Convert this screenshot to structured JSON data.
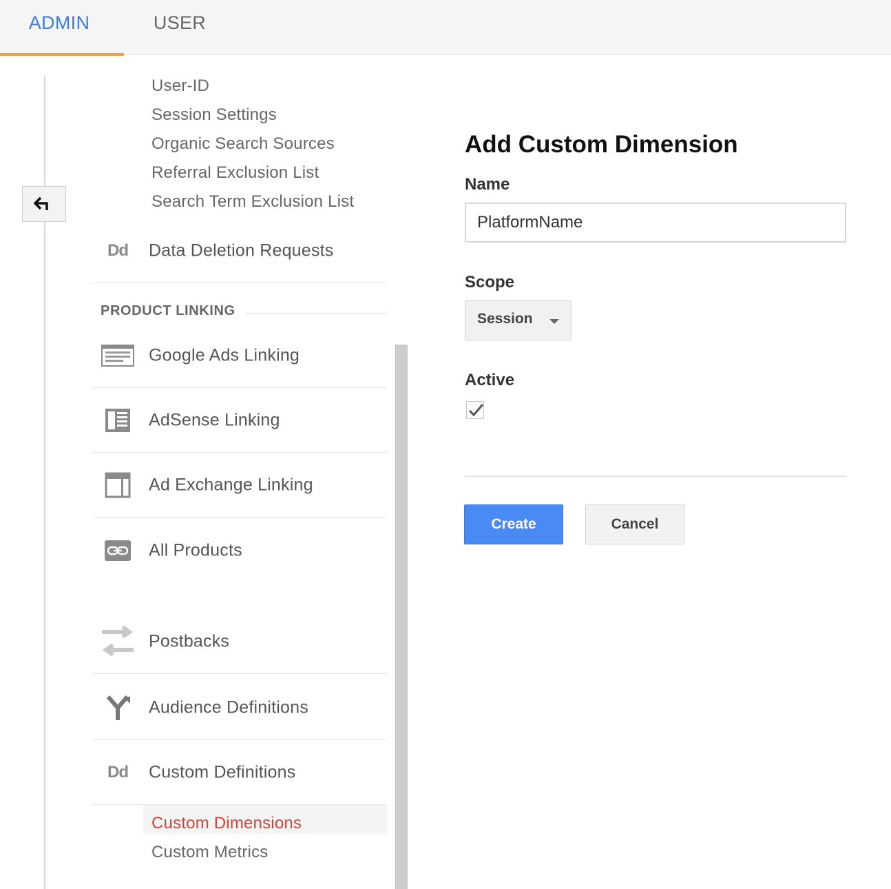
{
  "tabs": [
    {
      "label": "ADMIN",
      "active": true
    },
    {
      "label": "USER",
      "active": false
    }
  ],
  "nav": {
    "tracking_subitems": [
      "User-ID",
      "Session Settings",
      "Organic Search Sources",
      "Referral Exclusion List",
      "Search Term Exclusion List"
    ],
    "data_deletion": {
      "label": "Data Deletion Requests",
      "icon": "Dd"
    },
    "section_title": "PRODUCT LINKING",
    "linking_items": [
      {
        "label": "Google Ads Linking",
        "icon": "google-ads-icon"
      },
      {
        "label": "AdSense Linking",
        "icon": "adsense-icon"
      },
      {
        "label": "Ad Exchange Linking",
        "icon": "ad-exchange-icon"
      },
      {
        "label": "All Products",
        "icon": "link-icon"
      }
    ],
    "other_items": [
      {
        "label": "Postbacks",
        "icon": "postbacks-icon"
      },
      {
        "label": "Audience Definitions",
        "icon": "audience-icon"
      },
      {
        "label": "Custom Definitions",
        "icon": "Dd"
      }
    ],
    "custom_subitems": [
      {
        "label": "Custom Dimensions",
        "active": true
      },
      {
        "label": "Custom Metrics",
        "active": false
      }
    ]
  },
  "form": {
    "title": "Add Custom Dimension",
    "name_label": "Name",
    "name_value": "PlatformName",
    "scope_label": "Scope",
    "scope_value": "Session",
    "active_label": "Active",
    "active_checked": true,
    "create_label": "Create",
    "cancel_label": "Cancel"
  },
  "colors": {
    "accent_blue": "#4a8af4",
    "tab_underline": "#f2a03c",
    "active_item": "#d0473a"
  }
}
